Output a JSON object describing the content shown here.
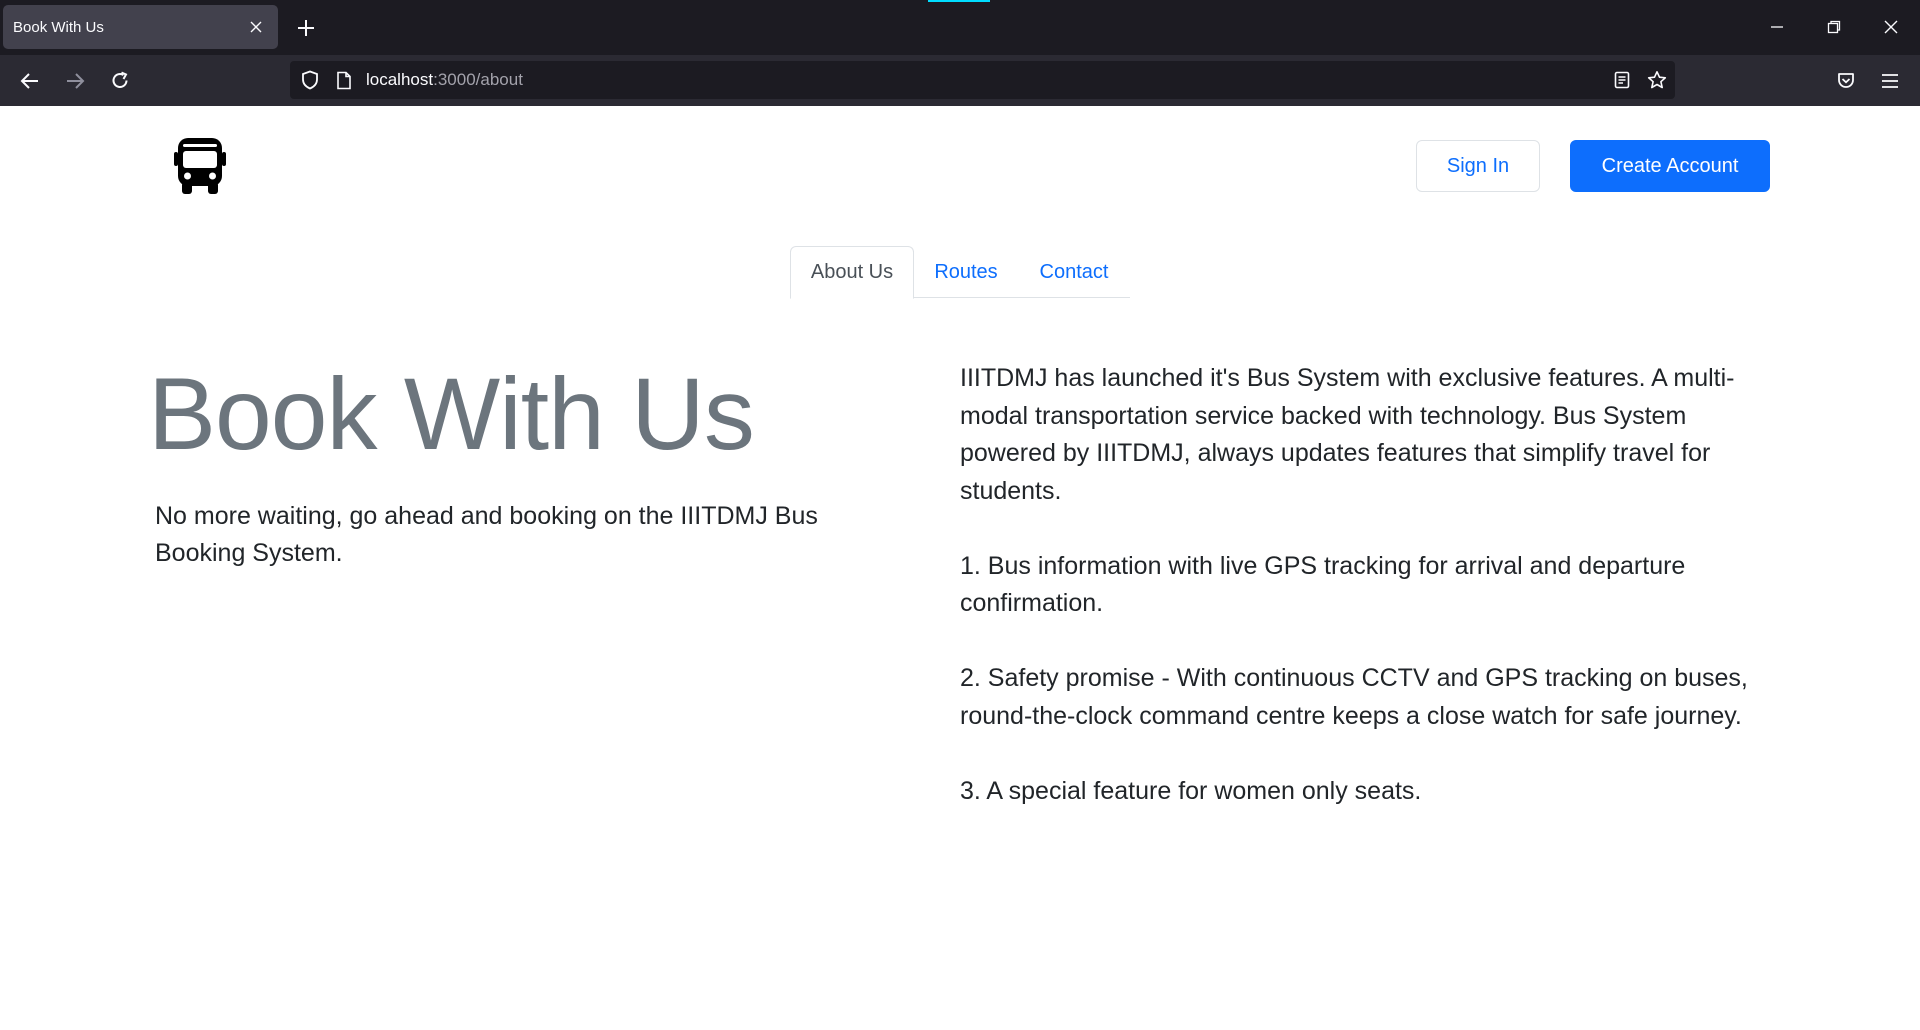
{
  "browser": {
    "tab_title": "Book With Us",
    "url_host": "localhost",
    "url_path": ":3000/about"
  },
  "site": {
    "logo_icon": "bus-icon",
    "signin_label": "Sign In",
    "create_account_label": "Create Account",
    "nav_tabs": [
      {
        "label": "About Us",
        "active": true
      },
      {
        "label": "Routes",
        "active": false
      },
      {
        "label": "Contact",
        "active": false
      }
    ],
    "hero_title": "Book With Us",
    "hero_subtitle": "No more waiting, go ahead and booking on the IIITDMJ Bus Booking System.",
    "about_paragraphs": [
      "IIITDMJ has launched it's Bus System with exclusive features. A multi-modal transportation service backed with technology. Bus System powered by IIITDMJ, always updates features that simplify travel for students.",
      "1. Bus information with live GPS tracking for arrival and departure confirmation.",
      "2. Safety promise - With continuous CCTV and GPS tracking on buses, round-the-clock command centre keeps a close watch for safe journey.",
      "3. A special feature for women only seats."
    ]
  },
  "colors": {
    "primary": "#0d6efd",
    "muted": "#6c757d",
    "chrome_dark": "#1c1b22",
    "chrome_toolbar": "#2b2a33"
  }
}
